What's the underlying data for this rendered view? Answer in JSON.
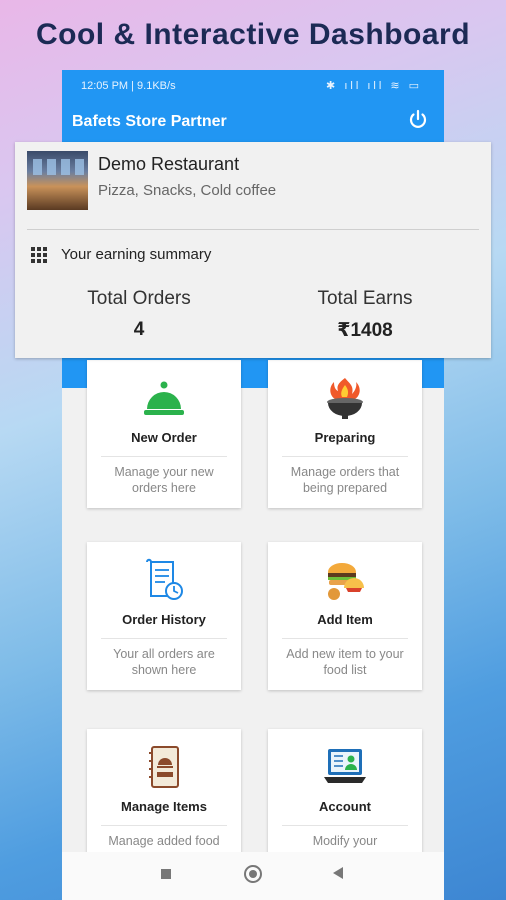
{
  "headline": "Cool & Interactive Dashboard",
  "status_bar": {
    "time": "12:05 PM | 9.1KB/s",
    "icons_text": "✱ ıll ıll ≋ ▭"
  },
  "app_bar": {
    "title": "Bafets Store Partner",
    "power_icon": "power-icon"
  },
  "restaurant": {
    "name": "Demo Restaurant",
    "tags": "Pizza, Snacks, Cold coffee"
  },
  "earning_summary": {
    "title": "Your earning summary",
    "total_orders_label": "Total Orders",
    "total_orders_value": "4",
    "total_earns_label": "Total Earns",
    "total_earns_value": "₹1408"
  },
  "cards": [
    {
      "title": "New Order",
      "desc_1": "Manage your new",
      "desc_2": "orders here",
      "icon": "bell-icon"
    },
    {
      "title": "Preparing",
      "desc_1": "Manage orders that",
      "desc_2": "being prepared",
      "icon": "grill-icon"
    },
    {
      "title": "Order History",
      "desc_1": "Your all orders are",
      "desc_2": "shown here",
      "icon": "receipt-clock-icon"
    },
    {
      "title": "Add Item",
      "desc_1": "Add new item to your",
      "desc_2": "food list",
      "icon": "food-icon"
    },
    {
      "title": "Manage Items",
      "desc_1": "Manage added food",
      "desc_2": "",
      "icon": "menu-book-icon"
    },
    {
      "title": "Account",
      "desc_1": "Modify your",
      "desc_2": "",
      "icon": "laptop-profile-icon"
    }
  ],
  "colors": {
    "primary": "#2196f3",
    "headline": "#1c2a55",
    "bell": "#2bb24c"
  }
}
